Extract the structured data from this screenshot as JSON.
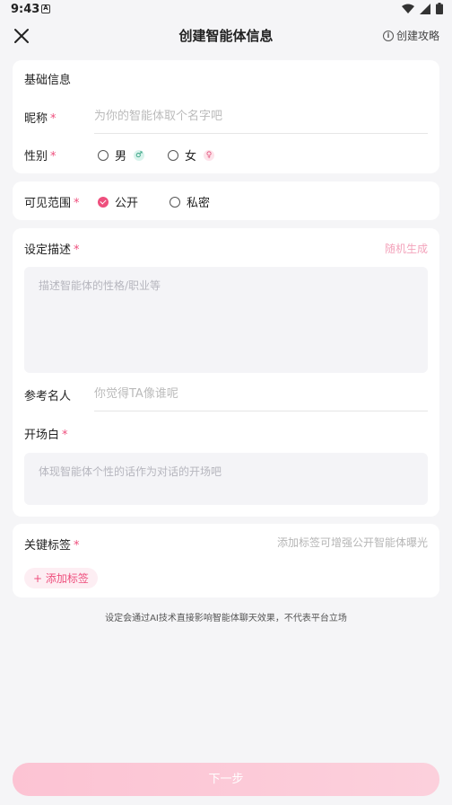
{
  "status_bar": {
    "time": "9:43",
    "notif_glyph": "A"
  },
  "header": {
    "title": "创建智能体信息",
    "guide_label": "创建攻略",
    "close_icon": "close-icon",
    "info_icon": "info-icon"
  },
  "basic": {
    "section_title": "基础信息",
    "nickname_label": "昵称",
    "nickname_placeholder": "为你的智能体取个名字吧",
    "gender_label": "性别",
    "gender_options": [
      {
        "label": "男",
        "symbol": "♂",
        "selected": false
      },
      {
        "label": "女",
        "symbol": "♀",
        "selected": false
      }
    ]
  },
  "visibility": {
    "label": "可见范围",
    "options": [
      {
        "label": "公开",
        "selected": true
      },
      {
        "label": "私密",
        "selected": false
      }
    ]
  },
  "settings": {
    "desc_label": "设定描述",
    "random_label": "随机生成",
    "desc_placeholder": "描述智能体的性格/职业等",
    "ref_label": "参考名人",
    "ref_placeholder": "你觉得TA像谁呢",
    "opening_label": "开场白",
    "opening_placeholder": "体现智能体个性的话作为对话的开场吧"
  },
  "tags": {
    "label": "关键标签",
    "hint": "添加标签可增强公开智能体曝光",
    "add_label": "+ 添加标签"
  },
  "required_mark": "*",
  "disclaimer": "设定会通过AI技术直接影响智能体聊天效果，不代表平台立场",
  "next_label": "下一步",
  "colors": {
    "accent": "#ee4f7d",
    "background": "#f5f5f7",
    "button_gradient_start": "#fcc3d3"
  }
}
